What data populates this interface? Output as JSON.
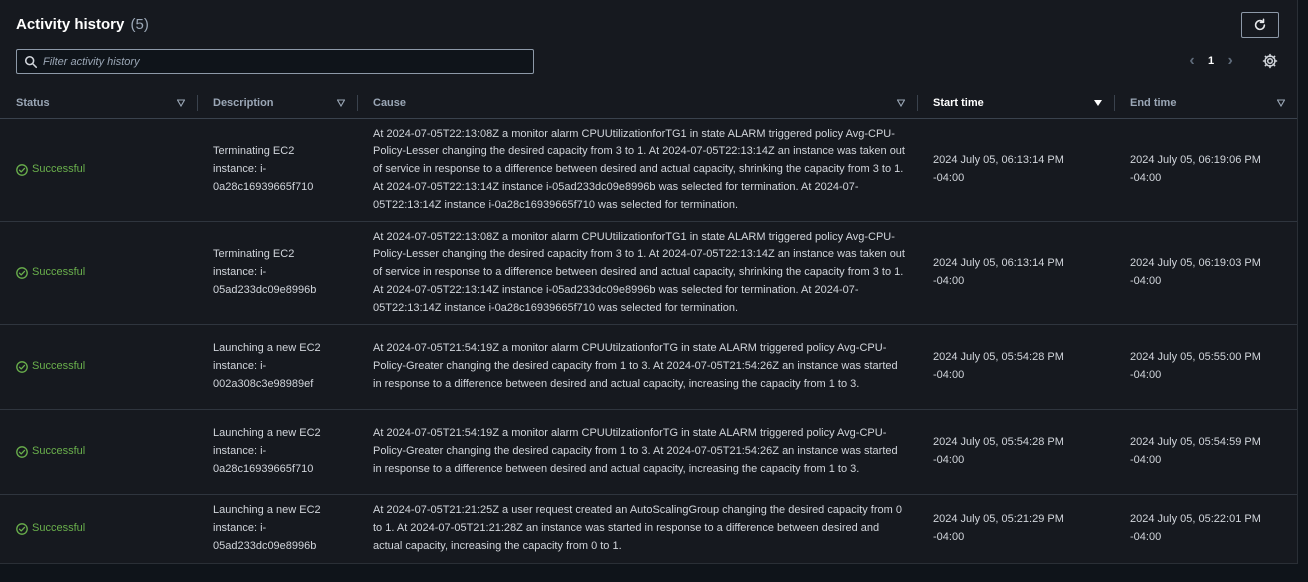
{
  "header": {
    "title": "Activity history",
    "count": "(5)"
  },
  "search": {
    "placeholder": "Filter activity history"
  },
  "pagination": {
    "current_page": "1"
  },
  "columns": {
    "status": "Status",
    "description": "Description",
    "cause": "Cause",
    "start_time": "Start time",
    "end_time": "End time"
  },
  "rows": [
    {
      "status": "Successful",
      "description": "Terminating EC2 instance: i-0a28c16939665f710",
      "cause": "At 2024-07-05T22:13:08Z a monitor alarm CPUUtilizationforTG1 in state ALARM triggered policy Avg-CPU-Policy-Lesser changing the desired capacity from 3 to 1. At 2024-07-05T22:13:14Z an instance was taken out of service in response to a difference between desired and actual capacity, shrinking the capacity from 3 to 1. At 2024-07-05T22:13:14Z instance i-05ad233dc09e8996b was selected for termination. At 2024-07-05T22:13:14Z instance i-0a28c16939665f710 was selected for termination.",
      "start_time": "2024 July 05, 06:13:14 PM -04:00",
      "end_time": "2024 July 05, 06:19:06 PM -04:00"
    },
    {
      "status": "Successful",
      "description": "Terminating EC2 instance: i-05ad233dc09e8996b",
      "cause": "At 2024-07-05T22:13:08Z a monitor alarm CPUUtilizationforTG1 in state ALARM triggered policy Avg-CPU-Policy-Lesser changing the desired capacity from 3 to 1. At 2024-07-05T22:13:14Z an instance was taken out of service in response to a difference between desired and actual capacity, shrinking the capacity from 3 to 1. At 2024-07-05T22:13:14Z instance i-05ad233dc09e8996b was selected for termination. At 2024-07-05T22:13:14Z instance i-0a28c16939665f710 was selected for termination.",
      "start_time": "2024 July 05, 06:13:14 PM -04:00",
      "end_time": "2024 July 05, 06:19:03 PM -04:00"
    },
    {
      "status": "Successful",
      "description": "Launching a new EC2 instance: i-002a308c3e98989ef",
      "cause": "At 2024-07-05T21:54:19Z a monitor alarm CPUUtilzationforTG in state ALARM triggered policy Avg-CPU-Policy-Greater changing the desired capacity from 1 to 3. At 2024-07-05T21:54:26Z an instance was started in response to a difference between desired and actual capacity, increasing the capacity from 1 to 3.",
      "start_time": "2024 July 05, 05:54:28 PM -04:00",
      "end_time": "2024 July 05, 05:55:00 PM -04:00"
    },
    {
      "status": "Successful",
      "description": "Launching a new EC2 instance: i-0a28c16939665f710",
      "cause": "At 2024-07-05T21:54:19Z a monitor alarm CPUUtilzationforTG in state ALARM triggered policy Avg-CPU-Policy-Greater changing the desired capacity from 1 to 3. At 2024-07-05T21:54:26Z an instance was started in response to a difference between desired and actual capacity, increasing the capacity from 1 to 3.",
      "start_time": "2024 July 05, 05:54:28 PM -04:00",
      "end_time": "2024 July 05, 05:54:59 PM -04:00"
    },
    {
      "status": "Successful",
      "description": "Launching a new EC2 instance: i-05ad233dc09e8996b",
      "cause": "At 2024-07-05T21:21:25Z a user request created an AutoScalingGroup changing the desired capacity from 0 to 1. At 2024-07-05T21:21:28Z an instance was started in response to a difference between desired and actual capacity, increasing the capacity from 0 to 1.",
      "start_time": "2024 July 05, 05:21:29 PM -04:00",
      "end_time": "2024 July 05, 05:22:01 PM -04:00"
    }
  ],
  "colors": {
    "success": "#6ab04c",
    "background": "#16191f",
    "text": "#d1d5db"
  }
}
